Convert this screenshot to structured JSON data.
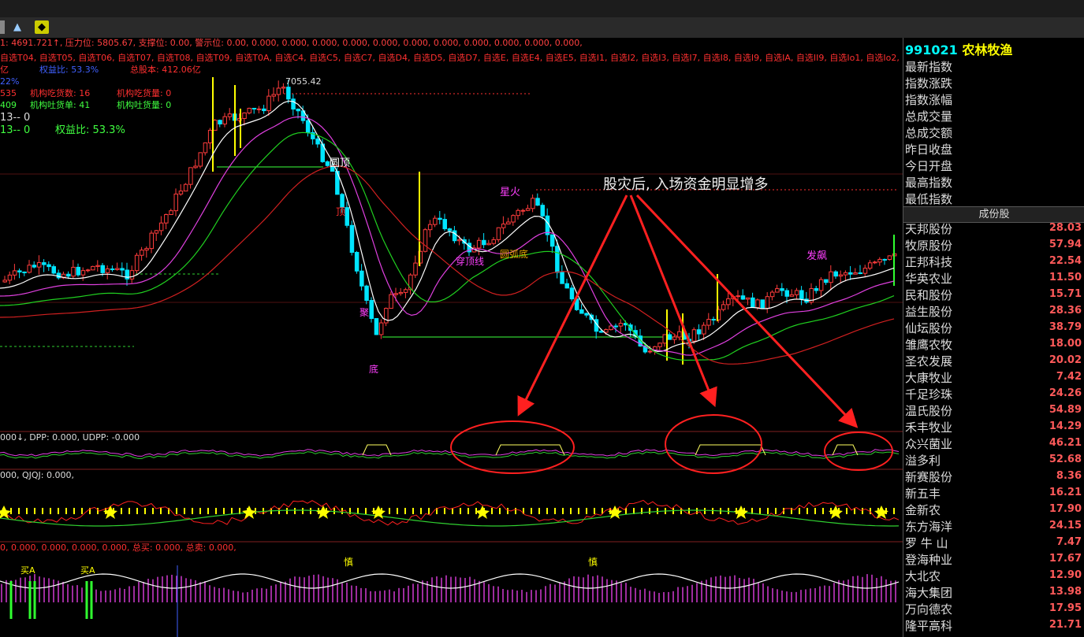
{
  "toolbar": {
    "icons": [
      "window-icon",
      "chart-icon",
      "diamond-icon"
    ]
  },
  "main_header": {
    "line1": "1: 4691.721↑, 压力位: 5805.67, 支撑位: 0.00, 警示位: 0.00, 0.000, 0.000, 0.000, 0.000, 0.000, 0.000, 0.000, 0.000, 0.000, 0.000, 0.000,",
    "line2": "自选T04, 自选T05, 自选T06, 自选T07, 自选T08, 自选T09, 自选T0A, 自选C4, 自选C5, 自选C7, 自选D4, 自选D5, 自选D7, 自选E, 自选E4, 自选E5, 自选I1, 自选I2, 自选I3, 自选I7, 自选I8, 自选I9, 自选IA, 自选II9, 自选Io1, 自选Io2,",
    "line3_a": "亿",
    "line3_b": "权益比: 53.3%",
    "line3_c": "总股本: 412.06亿",
    "line4": "22%",
    "line5_a": "535",
    "line5_b": "机构吃货数: 16",
    "line5_c": "机构吃货量: 0",
    "line6_a": "409",
    "line6_b": "机构吐货单: 41",
    "line6_c": "机构吐货量: 0",
    "line7": "13-- 0",
    "line8_a": "13-- 0",
    "line8_b": "权益比: 53.3%"
  },
  "price_labels": {
    "high": "7055.42",
    "yuanding": "圆顶",
    "xinghuo": "星火",
    "chuanxian": "穿顶线",
    "yuanhudi": "圆弧底",
    "fazhao": "发飙",
    "di": "底",
    "ding": "顶",
    "ju": "聚"
  },
  "annotation": "股灾后, 入场资金明显增多",
  "sub1_header": "000↓, DPP: 0.000, UDPP: -0.000",
  "sub2_header": "000, QJQJ: 0.000,",
  "sub3_header": "0, 0.000, 0.000, 0.000, 0.000, 总买: 0.000, 总卖: 0.000,",
  "sub3_labels": {
    "shen": "慎",
    "buy": "买A"
  },
  "sidebar": {
    "code": "991021",
    "name": "农林牧渔",
    "fields": [
      "最新指数",
      "指数涨跌",
      "指数涨幅",
      "总成交量",
      "总成交额",
      "昨日收盘",
      "今日开盘",
      "最高指数",
      "最低指数"
    ],
    "section": "成份股",
    "stocks": [
      {
        "name": "天邦股份",
        "value": "28.03"
      },
      {
        "name": "牧原股份",
        "value": "57.94"
      },
      {
        "name": "正邦科技",
        "value": "22.54"
      },
      {
        "name": "华英农业",
        "value": "11.50"
      },
      {
        "name": "民和股份",
        "value": "15.71"
      },
      {
        "name": "益生股份",
        "value": "28.36"
      },
      {
        "name": "仙坛股份",
        "value": "38.79"
      },
      {
        "name": "雏鹰农牧",
        "value": "18.00"
      },
      {
        "name": "圣农发展",
        "value": "20.02"
      },
      {
        "name": "大康牧业",
        "value": "7.42"
      },
      {
        "name": "千足珍珠",
        "value": "24.26"
      },
      {
        "name": "温氏股份",
        "value": "54.89"
      },
      {
        "name": "禾丰牧业",
        "value": "14.29"
      },
      {
        "name": "众兴菌业",
        "value": "46.21"
      },
      {
        "name": "溢多利",
        "value": "52.68"
      },
      {
        "name": "新赛股份",
        "value": "8.36"
      },
      {
        "name": "新五丰",
        "value": "16.21"
      },
      {
        "name": "金新农",
        "value": "17.90"
      },
      {
        "name": "东方海洋",
        "value": "24.15"
      },
      {
        "name": "罗 牛 山",
        "value": "7.47"
      },
      {
        "name": "登海种业",
        "value": "17.67"
      },
      {
        "name": "大北农",
        "value": "12.90"
      },
      {
        "name": "海大集团",
        "value": "13.98"
      },
      {
        "name": "万向德农",
        "value": "17.95"
      },
      {
        "name": "隆平高科",
        "value": "21.71"
      }
    ]
  },
  "colors": {
    "up": "#ff3c3c",
    "down": "#00e5ff",
    "accent": "#ffff00",
    "ma_white": "#ffffff",
    "ma_magenta": "#e040e0",
    "ma_green": "#20d020",
    "ma_red": "#d02020"
  }
}
